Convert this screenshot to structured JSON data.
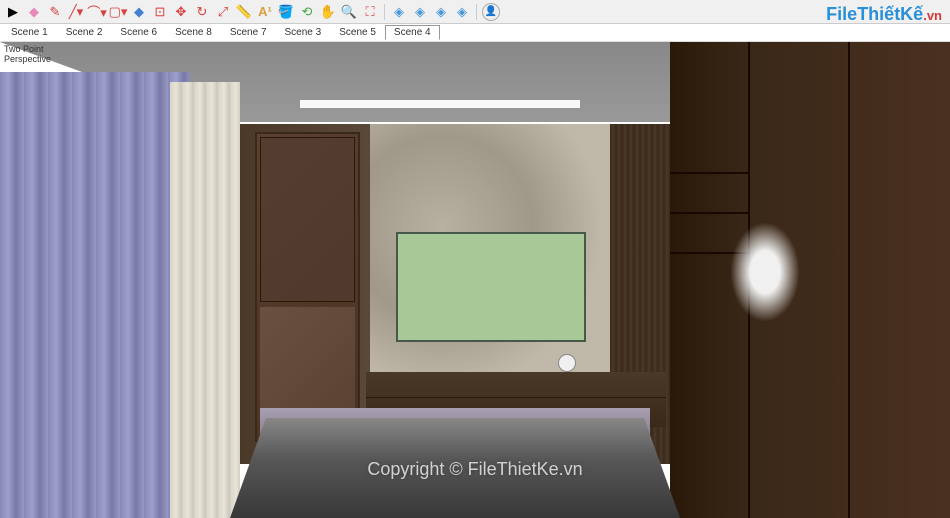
{
  "toolbar": {
    "tools": [
      {
        "name": "select",
        "glyph": "▶",
        "color": "#000"
      },
      {
        "name": "eraser",
        "glyph": "◆",
        "color": "#e888b8"
      },
      {
        "name": "pencil",
        "glyph": "✎",
        "color": "#d84040"
      },
      {
        "name": "line",
        "glyph": "╱",
        "color": "#d84040"
      },
      {
        "name": "arc",
        "glyph": "⌒",
        "color": "#d84040"
      },
      {
        "name": "shape",
        "glyph": "▢",
        "color": "#d84040"
      },
      {
        "name": "pushpull",
        "glyph": "◆",
        "color": "#4080d0"
      },
      {
        "name": "offset",
        "glyph": "⊡",
        "color": "#d84040"
      },
      {
        "name": "move",
        "glyph": "✥",
        "color": "#d84040"
      },
      {
        "name": "rotate",
        "glyph": "↻",
        "color": "#d84040"
      },
      {
        "name": "scale",
        "glyph": "⤢",
        "color": "#d84040"
      },
      {
        "name": "tape",
        "glyph": "▭",
        "color": "#d8a040"
      },
      {
        "name": "text",
        "glyph": "A",
        "color": "#d8a040"
      },
      {
        "name": "paint",
        "glyph": "🪣",
        "color": "#a06838"
      },
      {
        "name": "orbit",
        "glyph": "⟲",
        "color": "#48a848"
      },
      {
        "name": "pan",
        "glyph": "✋",
        "color": "#d8a040"
      },
      {
        "name": "zoom",
        "glyph": "🔍",
        "color": "#48a848"
      },
      {
        "name": "zoom-extents",
        "glyph": "⛶",
        "color": "#d84040"
      },
      {
        "name": "layers1",
        "glyph": "◈",
        "color": "#4898d8"
      },
      {
        "name": "layers2",
        "glyph": "◈",
        "color": "#4898d8"
      },
      {
        "name": "layers3",
        "glyph": "◈",
        "color": "#4898d8"
      },
      {
        "name": "layers4",
        "glyph": "◈",
        "color": "#4898d8"
      },
      {
        "name": "user",
        "glyph": "👤",
        "color": "#888"
      }
    ]
  },
  "scenes": {
    "tabs": [
      {
        "label": "Scene 1",
        "active": false
      },
      {
        "label": "Scene 2",
        "active": false
      },
      {
        "label": "Scene 6",
        "active": false
      },
      {
        "label": "Scene 8",
        "active": false
      },
      {
        "label": "Scene 7",
        "active": false
      },
      {
        "label": "Scene 3",
        "active": false
      },
      {
        "label": "Scene 5",
        "active": false
      },
      {
        "label": "Scene 4",
        "active": true
      }
    ]
  },
  "viewport": {
    "projection_line1": "Two Point",
    "projection_line2": "Perspective"
  },
  "watermark": "Copyright © FileThietKe.vn",
  "logo": {
    "part1": "File",
    "part2": "ThiếtKế",
    "part3": ".vn"
  }
}
